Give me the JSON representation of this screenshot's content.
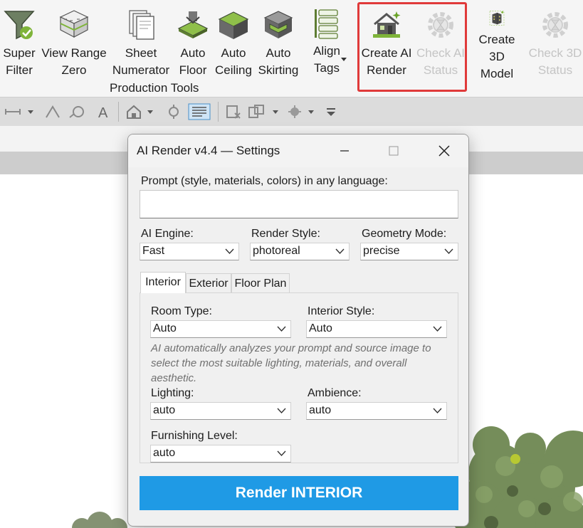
{
  "ribbon": {
    "buttons": [
      {
        "label": "Super\nFilter",
        "enabled": true,
        "icon": "funnel-icon"
      },
      {
        "label": "View Range\nZero",
        "enabled": true,
        "icon": "building-layers-icon"
      },
      {
        "label": "Sheet\nNumerator",
        "enabled": true,
        "icon": "sheets-icon"
      },
      {
        "label": "Auto\nFloor",
        "enabled": true,
        "icon": "floor-icon"
      },
      {
        "label": "Auto\nCeiling",
        "enabled": true,
        "icon": "ceiling-icon"
      },
      {
        "label": "Auto\nSkirting",
        "enabled": true,
        "icon": "skirting-icon"
      },
      {
        "label": "Align\nTags",
        "enabled": true,
        "icon": "align-tags-icon"
      },
      {
        "label": "Create AI\nRender",
        "enabled": true,
        "icon": "house-sparkle-icon"
      },
      {
        "label": "Check AI\nStatus",
        "enabled": false,
        "icon": "gear-hourglass-icon"
      },
      {
        "label": "Create 3D\nModel",
        "enabled": true,
        "icon": "3d-building-icon"
      },
      {
        "label": "Check 3D\nStatus",
        "enabled": false,
        "icon": "gear-hourglass-icon"
      }
    ],
    "panel_title": "Production Tools",
    "highlight_color": "#e03a3a"
  },
  "dialog": {
    "title": "AI Render v4.4 — Settings",
    "prompt_label": "Prompt (style, materials, colors) in any language:",
    "prompt_value": "",
    "ai_engine": {
      "label": "AI Engine:",
      "value": "Fast"
    },
    "render_style": {
      "label": "Render Style:",
      "value": "photoreal"
    },
    "geometry_mode": {
      "label": "Geometry Mode:",
      "value": "precise"
    },
    "tabs": [
      "Interior",
      "Exterior",
      "Floor Plan"
    ],
    "active_tab": "Interior",
    "room_type": {
      "label": "Room Type:",
      "value": "Auto"
    },
    "interior_style": {
      "label": "Interior Style:",
      "value": "Auto"
    },
    "hint": "AI automatically analyzes your prompt and source image to select the most suitable lighting, materials, and overall aesthetic.",
    "lighting": {
      "label": "Lighting:",
      "value": "auto"
    },
    "ambience": {
      "label": "Ambience:",
      "value": "auto"
    },
    "furnishing_level": {
      "label": "Furnishing Level:",
      "value": "auto"
    },
    "render_button": "Render INTERIOR",
    "render_button_color": "#1f9ae5"
  }
}
